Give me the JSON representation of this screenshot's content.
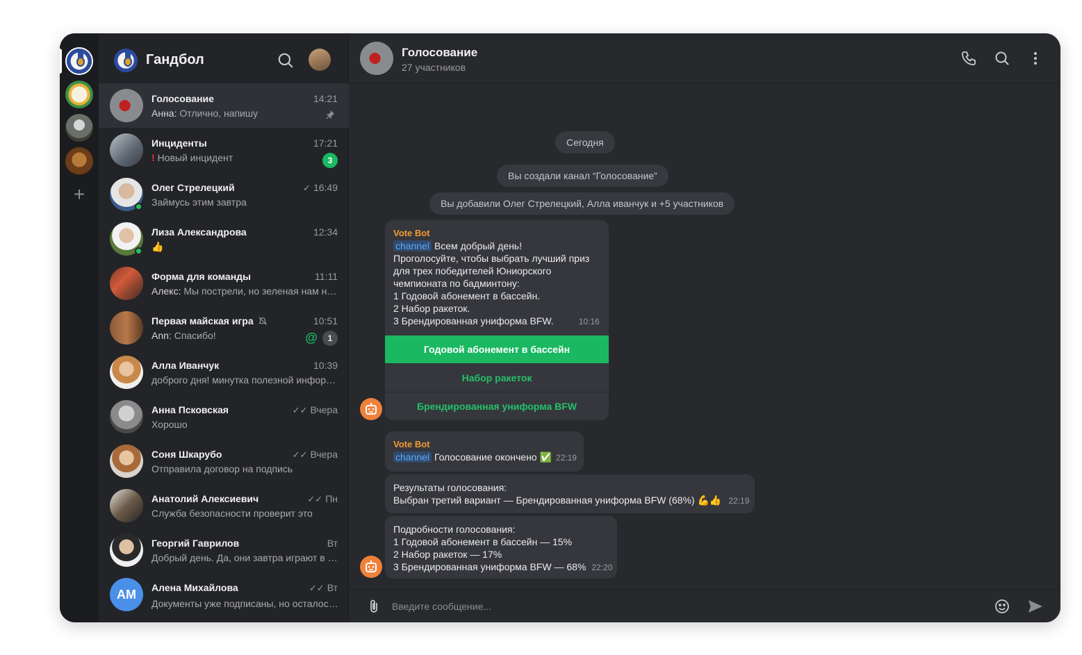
{
  "workspace": {
    "title": "Гандбол"
  },
  "chat_list": [
    {
      "name": "Голосование",
      "time": "14:21",
      "sender": "Анна:",
      "preview": "Отлично, напишу",
      "pinned": true
    },
    {
      "name": "Инциденты",
      "time": "17:21",
      "alert": "!",
      "preview": "Новый инцидент",
      "unread": "3"
    },
    {
      "name": "Олег Стрелецкий",
      "time": "16:49",
      "check": "✓",
      "preview": "Займусь этим завтра"
    },
    {
      "name": "Лиза Александрова",
      "time": "12:34",
      "preview": "👍"
    },
    {
      "name": "Форма для команды",
      "time": "11:11",
      "sender": "Алекс:",
      "preview": "Мы пострели, но зеленая нам не подошла"
    },
    {
      "name": "Первая майская игра",
      "time": "10:51",
      "sender": "Ann:",
      "preview": "Спасибо!",
      "mention": "@",
      "unread": "1",
      "muted": true
    },
    {
      "name": "Алла Иванчук",
      "time": "10:39",
      "preview": "доброго дня! минутка полезной информации"
    },
    {
      "name": "Анна Псковская",
      "time": "Вчера",
      "check": "✓✓",
      "preview": "Хорошо"
    },
    {
      "name": "Соня Шкарубо",
      "time": "Вчера",
      "check": "✓✓",
      "preview": "Отправила договор на подпись"
    },
    {
      "name": "Анатолий Алексиевич",
      "time": "Пн",
      "check": "✓✓",
      "preview": "Служба безопасности проверит это"
    },
    {
      "name": "Георгий Гаврилов",
      "time": "Вт",
      "preview": "Добрый день. Да, они завтра играют в полдень"
    },
    {
      "name": "Алена Михайлова",
      "time": "Вт",
      "check": "✓✓",
      "initials": "AM",
      "preview": "Документы уже подписаны, но осталось согласование"
    }
  ],
  "chat": {
    "title": "Голосование",
    "subtitle": "27 участников",
    "date_divider": "Сегодня",
    "system_1": "Вы создали канал “Голосование”",
    "system_2": "Вы добавили Олег Стрелецкий, Алла иванчук и +5 участников",
    "msg1": {
      "sender": "Vote Bot",
      "tag": "channel",
      "first": "Всем добрый день!",
      "lines": [
        "Проголосуйте, чтобы выбрать лучший приз",
        "для трех победителей Юниорского",
        "чемпионата по бадминтону:",
        "1 Годовой абонемент в бассейн.",
        "2 Набор ракеток."
      ],
      "last": "3 Брендированная униформа BFW.",
      "time": "10:16"
    },
    "vote_options": [
      "Годовой абонемент в бассейн",
      "Набор ракеток",
      "Брендированная униформа BFW"
    ],
    "msg2": {
      "sender": "Vote Bot",
      "tag": "channel",
      "text": "Голосование окончено",
      "emoji": "✅",
      "time": "22:19"
    },
    "msg3": {
      "line1": "Результаты голосования:",
      "line2": "Выбран третий вариант — Брендированная униформа BFW (68%)",
      "emoji": "💪👍",
      "time": "22:19"
    },
    "msg4": {
      "lines": [
        "Подробности голосования:",
        "1 Годовой абонемент в бассейн — 15%",
        "2 Набор ракеток — 17%"
      ],
      "last": "3 Брендированная униформа BFW — 68%",
      "time": "22:20"
    },
    "composer_placeholder": "Введите сообщение..."
  },
  "colors": {
    "accent": "#19b861",
    "bot_orange": "#f0813a",
    "sender_orange": "#f29a33",
    "unread_green": "#19b861",
    "link_blue": "#5aa9ff"
  }
}
